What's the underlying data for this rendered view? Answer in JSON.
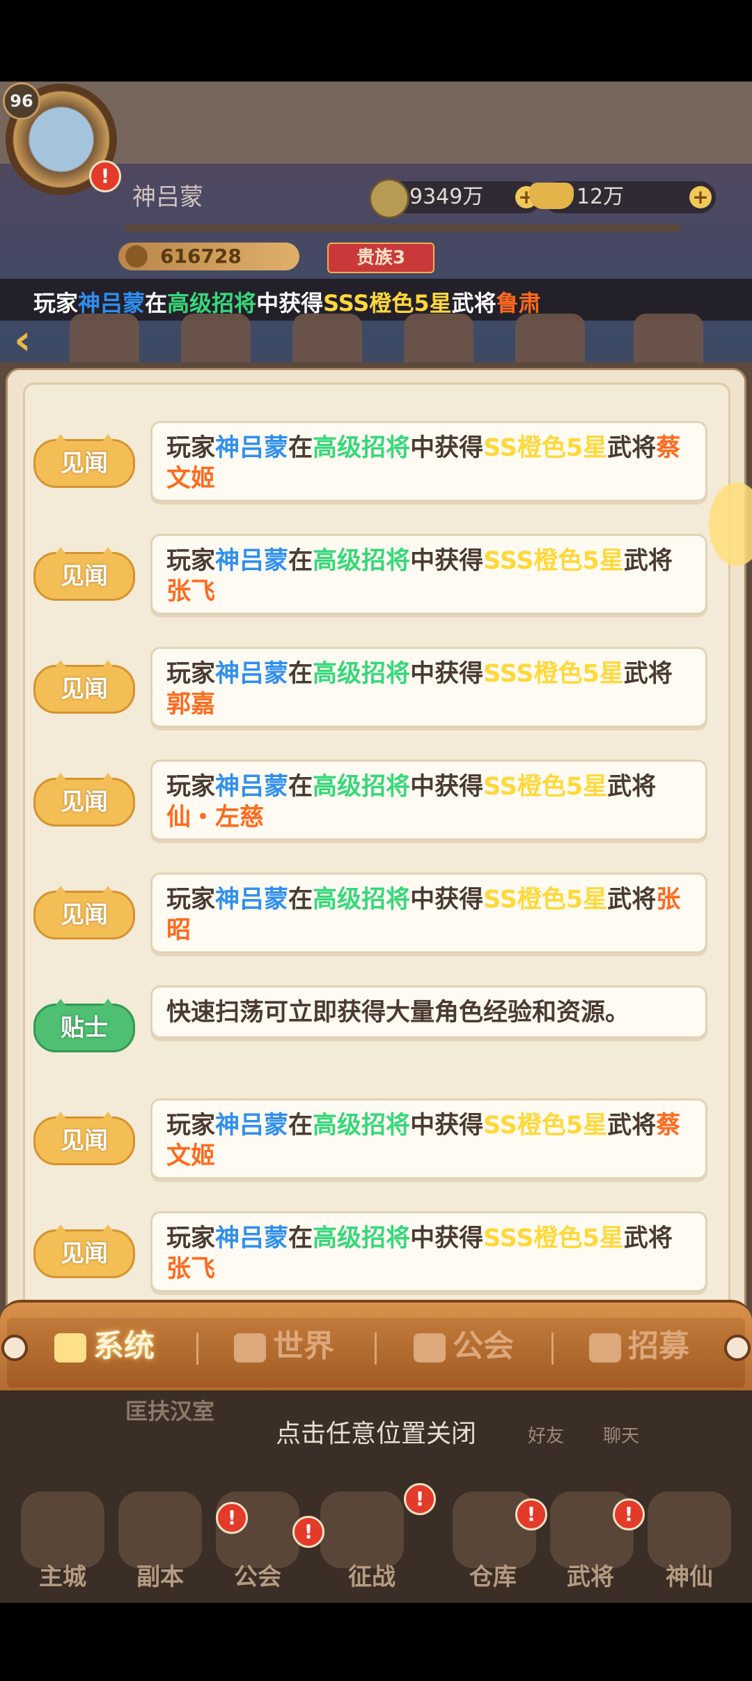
{
  "player": {
    "level": "96",
    "name": "神吕蒙",
    "alert": "!",
    "coins": "9349万",
    "gold": "12万",
    "power": "616728",
    "noble": "贵族3"
  },
  "ticker": {
    "parts": [
      "玩家",
      "神吕蒙",
      "在",
      "高级招将",
      "中获得",
      "SSS橙色5星",
      "武将",
      "鲁肃"
    ]
  },
  "messages": [
    {
      "tag": "见闻",
      "type": "news",
      "parts": [
        "玩家",
        "神吕蒙",
        "在",
        "高级招将",
        "中获得",
        "SS橙色5星",
        "武将",
        "蔡文姬"
      ]
    },
    {
      "tag": "见闻",
      "type": "news",
      "parts": [
        "玩家",
        "神吕蒙",
        "在",
        "高级招将",
        "中获得",
        "SSS橙色5星",
        "武将",
        "张飞"
      ]
    },
    {
      "tag": "见闻",
      "type": "news",
      "parts": [
        "玩家",
        "神吕蒙",
        "在",
        "高级招将",
        "中获得",
        "SSS橙色5星",
        "武将",
        "郭嘉"
      ]
    },
    {
      "tag": "见闻",
      "type": "news",
      "parts": [
        "玩家",
        "神吕蒙",
        "在",
        "高级招将",
        "中获得",
        "SS橙色5星",
        "武将",
        "仙・左慈"
      ]
    },
    {
      "tag": "见闻",
      "type": "news",
      "parts": [
        "玩家",
        "神吕蒙",
        "在",
        "高级招将",
        "中获得",
        "SS橙色5星",
        "武将",
        "张昭"
      ]
    },
    {
      "tag": "贴士",
      "type": "tip",
      "text": "快速扫荡可立即获得大量角色经验和资源。"
    },
    {
      "tag": "见闻",
      "type": "news",
      "parts": [
        "玩家",
        "神吕蒙",
        "在",
        "高级招将",
        "中获得",
        "SS橙色5星",
        "武将",
        "蔡文姬"
      ]
    },
    {
      "tag": "见闻",
      "type": "news",
      "parts": [
        "玩家",
        "神吕蒙",
        "在",
        "高级招将",
        "中获得",
        "SSS橙色5星",
        "武将",
        "张飞"
      ]
    }
  ],
  "tabs": [
    {
      "label": "系统",
      "icon": "megaphone-icon",
      "active": true
    },
    {
      "label": "世界",
      "icon": "cat-face-icon",
      "active": false
    },
    {
      "label": "公会",
      "icon": "guild-flag-icon",
      "active": false
    },
    {
      "label": "招募",
      "icon": "recruit-icon",
      "active": false
    }
  ],
  "close_hint": "点击任意位置关闭",
  "guild_banner": "匡扶汉室",
  "small_nav": [
    "好友",
    "聊天"
  ],
  "bottom_nav": [
    "主城",
    "副本",
    "公会",
    "征战",
    "仓库",
    "武将",
    "神仙"
  ],
  "colors": {
    "player_name": "#2f8ff0",
    "pool_name": "#36d87a",
    "rarity": "#ffd83a",
    "hero_name": "#ff6a1e",
    "news_tag": "#f3be55",
    "tip_tag": "#4fbf72"
  }
}
